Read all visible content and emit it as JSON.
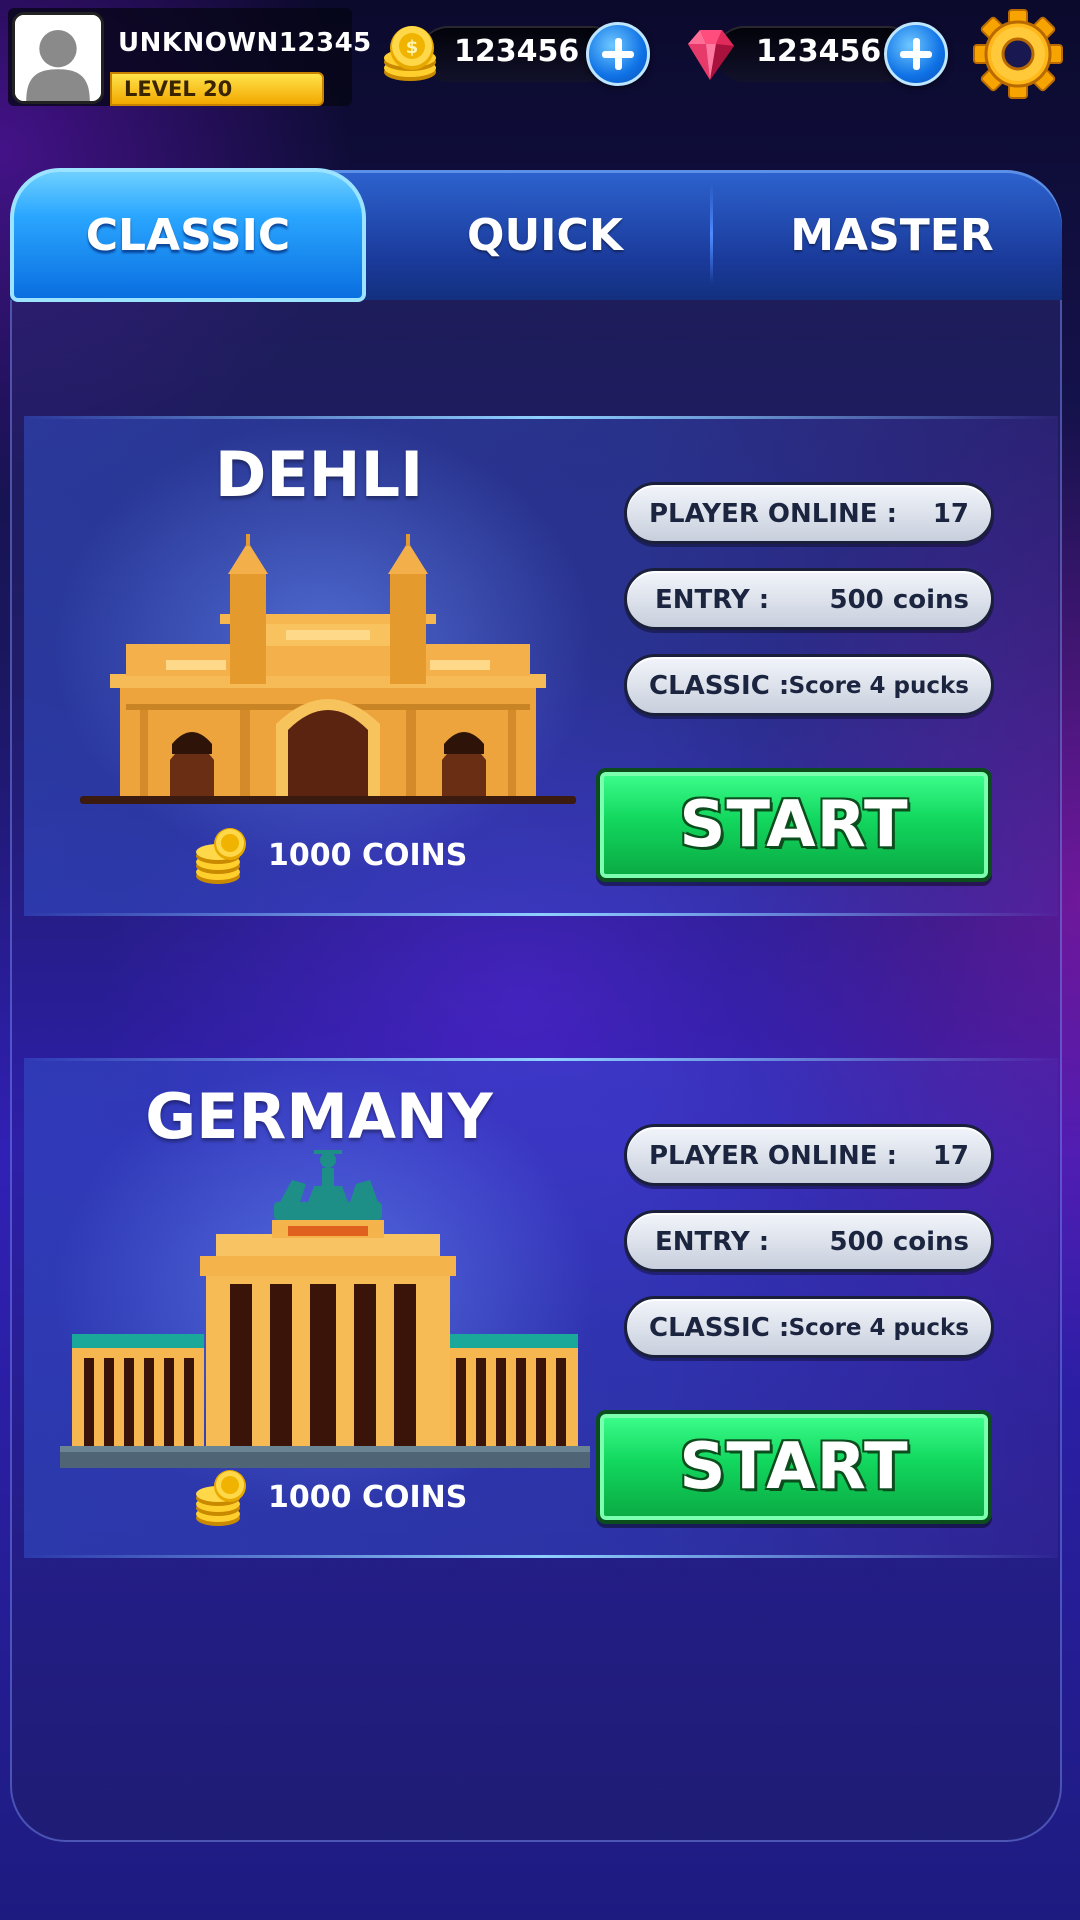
{
  "player": {
    "username": "UNKNOWN12345",
    "level_label": "LEVEL 20"
  },
  "currencies": {
    "coins": "123456",
    "gems": "123456"
  },
  "tabs": [
    {
      "label": "CLASSIC",
      "active": true
    },
    {
      "label": "QUICK",
      "active": false
    },
    {
      "label": "MASTER",
      "active": false
    }
  ],
  "cities": [
    {
      "name": "DEHLI",
      "players_online_label": "PLAYER ONLINE :",
      "players_online": "17",
      "entry_label": "ENTRY :",
      "entry_value": "500 coins",
      "mode_label": "CLASSIC :",
      "mode_value": "Score 4 pucks",
      "reward": "1000 COINS",
      "start_label": "START"
    },
    {
      "name": "GERMANY",
      "players_online_label": "PLAYER ONLINE :",
      "players_online": "17",
      "entry_label": "ENTRY :",
      "entry_value": "500 coins",
      "mode_label": "CLASSIC :",
      "mode_value": "Score 4 pucks",
      "reward": "1000 COINS",
      "start_label": "START"
    }
  ],
  "colors": {
    "start_green": "#12d75e",
    "tab_active": "#2aa6ff",
    "level_bar": "#f2a800",
    "gem": "#e0245e",
    "coin": "#f5b800"
  },
  "icons": {
    "avatar": "avatar-icon",
    "coin": "coin-icon",
    "gem": "gem-icon",
    "plus": "plus-icon",
    "settings": "gear-icon",
    "landmark_1": "india-gate-icon",
    "landmark_2": "brandenburg-gate-icon",
    "reward": "coin-stack-icon"
  }
}
